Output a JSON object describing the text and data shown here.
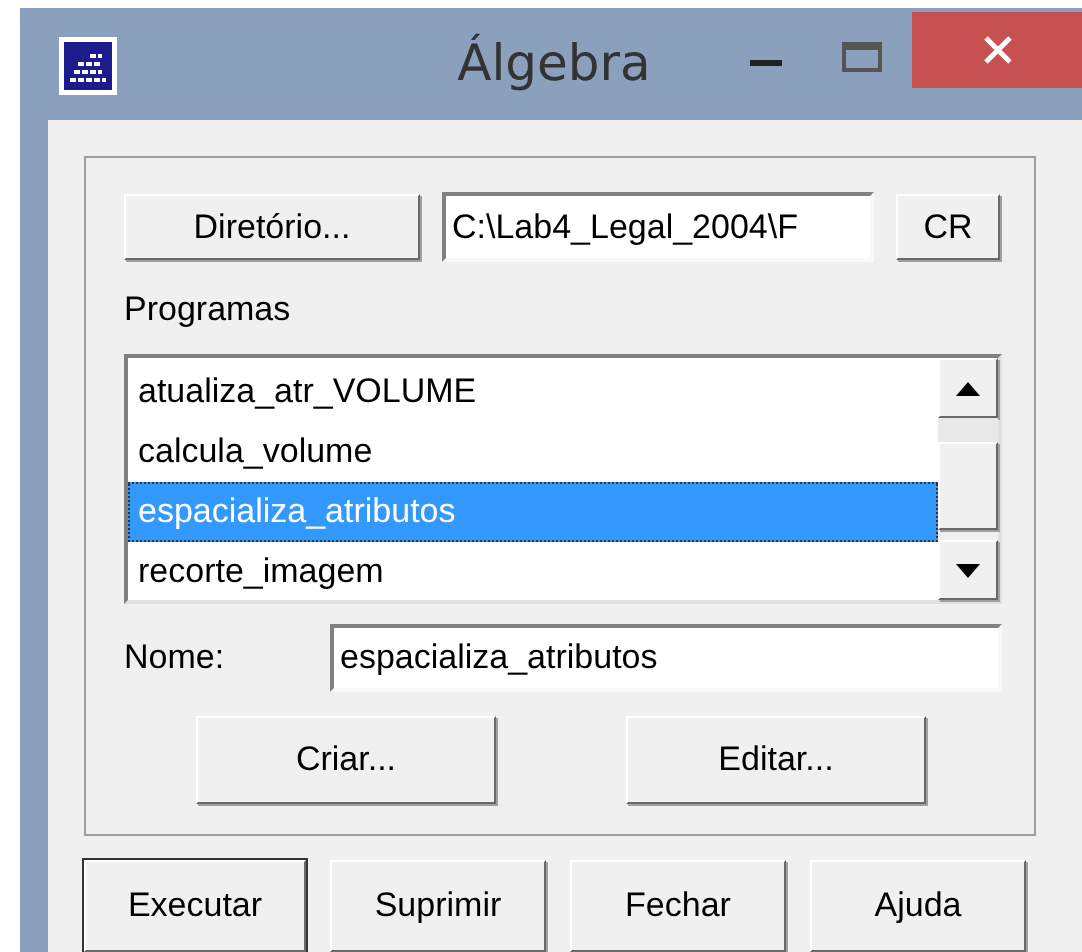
{
  "window": {
    "title": "Álgebra"
  },
  "directory_button": "Diretório...",
  "directory_field": {
    "value": "C:\\Lab4_Legal_2004\\F"
  },
  "cr_button": "CR",
  "programs_label": "Programas",
  "programs": [
    {
      "label": "atualiza_atr_VOLUME",
      "selected": false
    },
    {
      "label": "calcula_volume",
      "selected": false
    },
    {
      "label": "espacializa_atributos",
      "selected": true
    },
    {
      "label": "recorte_imagem",
      "selected": false
    }
  ],
  "name_label": "Nome:",
  "name_field": {
    "value": "espacializa_atributos"
  },
  "group_buttons": [
    "Criar...",
    "Editar..."
  ],
  "buttons": [
    "Executar",
    "Suprimir",
    "Fechar",
    "Ajuda"
  ]
}
